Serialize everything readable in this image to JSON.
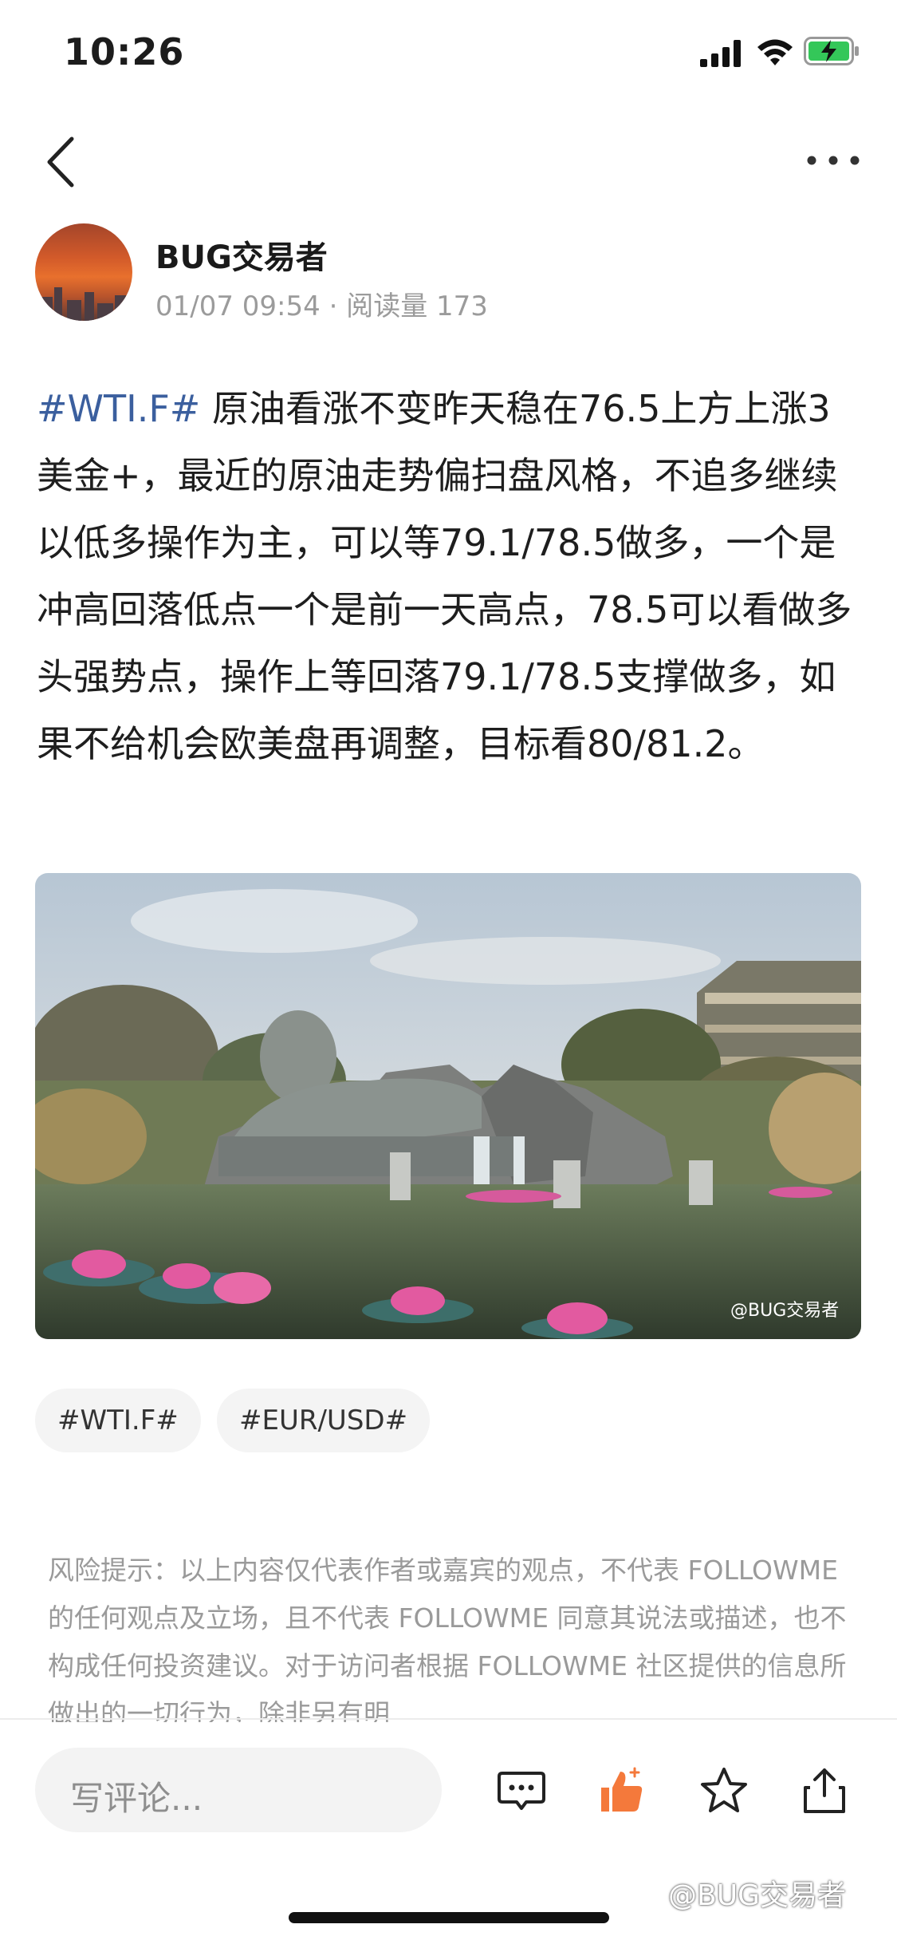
{
  "status_bar": {
    "time": "10:26"
  },
  "author": {
    "name": "BUG交易者",
    "date": "01/07 09:54",
    "separator": "·",
    "reads": "阅读量 173"
  },
  "post": {
    "tag": "#WTI.F#",
    "text": " 原油看涨不变昨天稳在76.5上方上涨3美金+，最近的原油走势偏扫盘风格，不追多继续以低多操作为主，可以等79.1/78.5做多，一个是冲高回落低点一个是前一天高点，78.5可以看做多头强势点，操作上等回落79.1/78.5支撑做多，如果不给机会欧美盘再调整，目标看80/81.2。"
  },
  "image": {
    "watermark": "@BUG交易者"
  },
  "tags": [
    "#WTI.F#",
    "#EUR/USD#"
  ],
  "disclaimer": "风险提示：以上内容仅代表作者或嘉宾的观点，不代表 FOLLOWME 的任何观点及立场，且不代表 FOLLOWME 同意其说法或描述，也不构成任何投资建议。对于访问者根据 FOLLOWME 社区提供的信息所做出的一切行为，除非另有明",
  "bottom_bar": {
    "comment_placeholder": "写评论...",
    "like_color": "#f4793b"
  },
  "corner_watermark": "@BUG交易者",
  "icons": [
    "back-icon",
    "more-icon",
    "comment-icon",
    "like-icon",
    "favorite-icon",
    "share-icon"
  ]
}
